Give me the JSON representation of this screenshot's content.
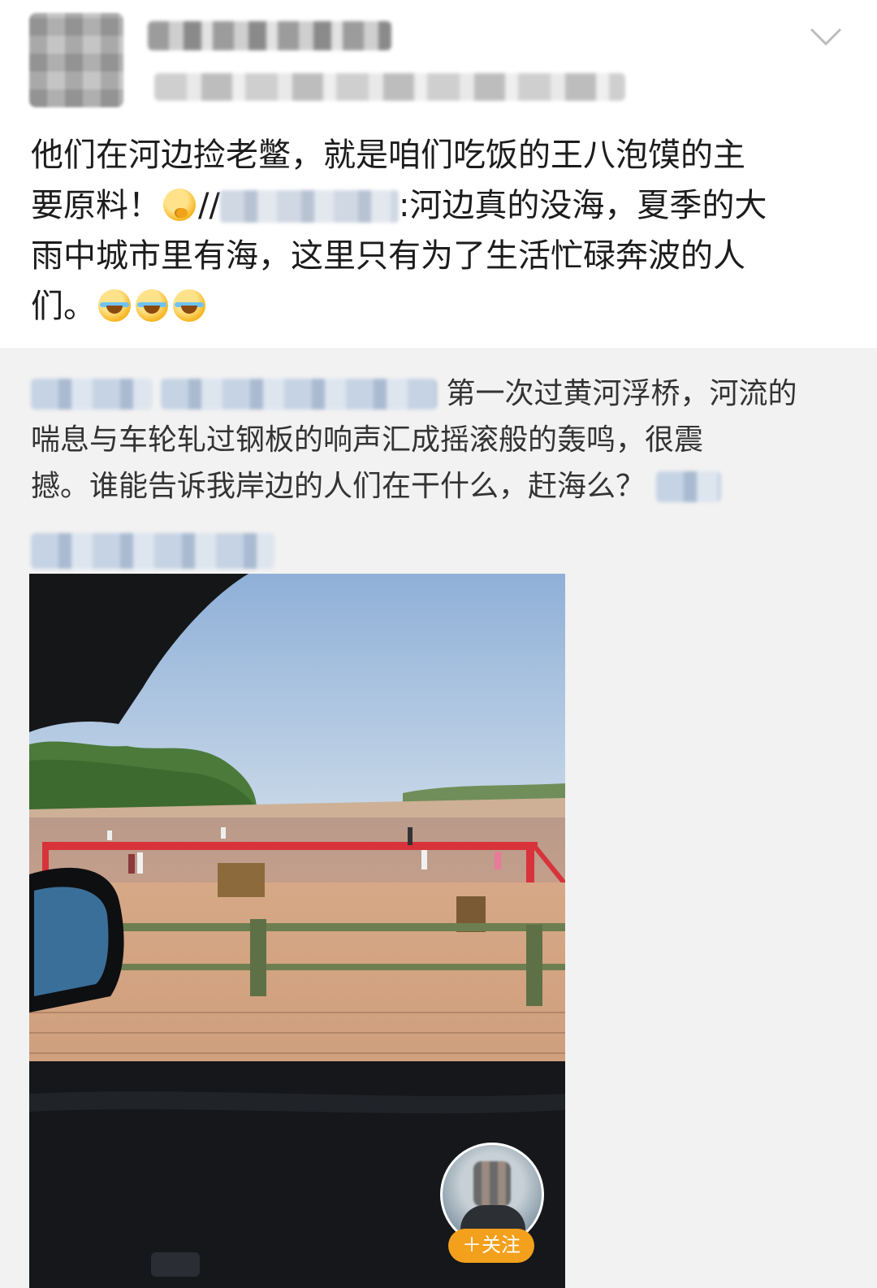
{
  "post": {
    "text_line1": "他们在河边捡老鳖，就是咱们吃饭的王八泡馍的主",
    "text_line2_a": "要原料！",
    "text_line2_b": "//",
    "text_line2_c": ":河边真的没海，夏季的大",
    "text_line3": "雨中城市里有海，这里只有为了生活忙碌奔波的人",
    "text_line4": "们。",
    "emoji_think": "thinking-face-icon",
    "emoji_cry": "crying-laughing-icon"
  },
  "repost": {
    "line1": "第一次过黄河浮桥，河流的",
    "line2": "喘息与车轮轧过钢板的响声汇成摇滚般的轰鸣，很震",
    "line3": "撼。谁能告诉我岸边的人们在干什么，赶海么？"
  },
  "video": {
    "follow_label": "＋关注"
  },
  "colors": {
    "repost_bg": "#f2f2f2",
    "follow_btn": "#f3a01c"
  }
}
